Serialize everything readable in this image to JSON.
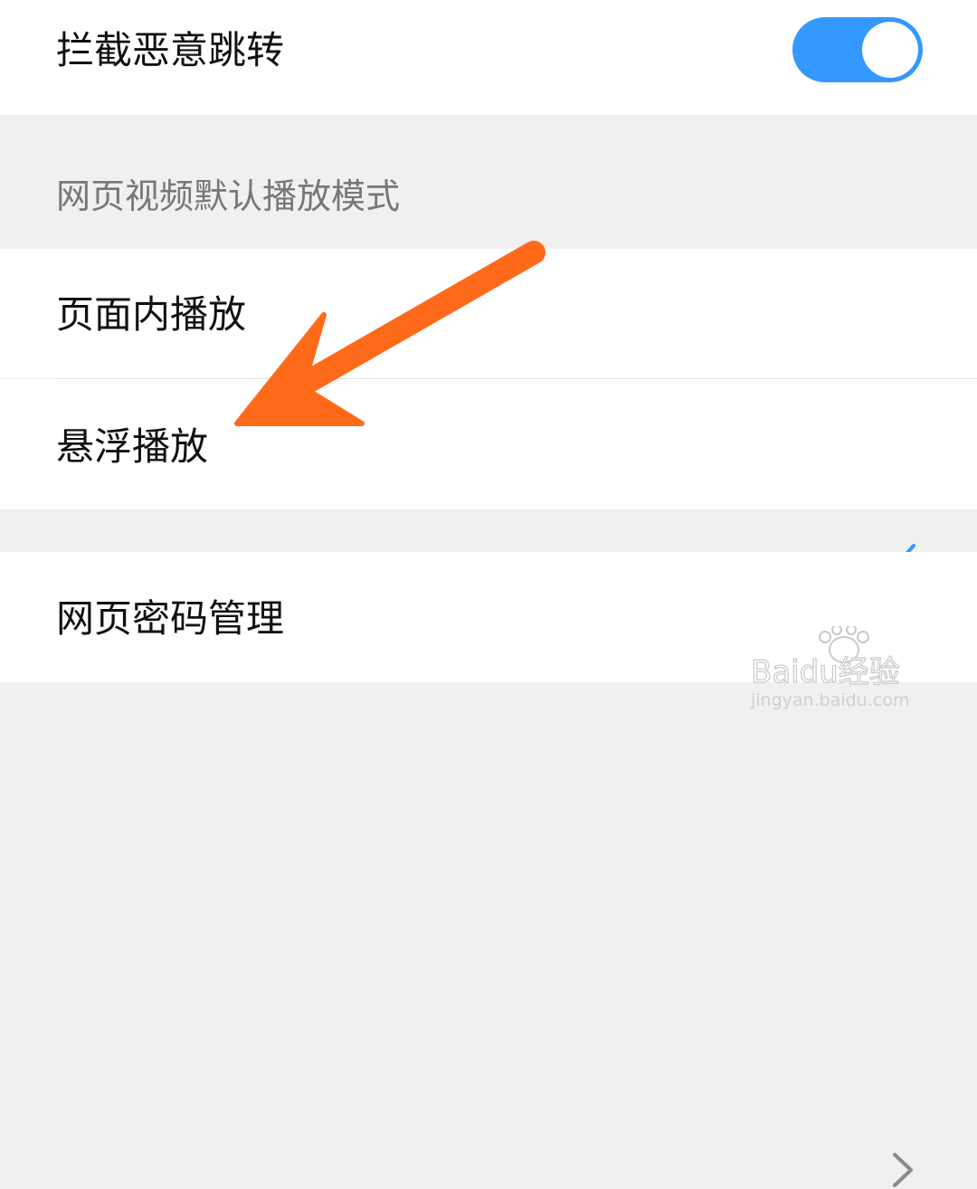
{
  "settings": {
    "block_redirect": {
      "label": "拦截恶意跳转",
      "enabled": true
    },
    "video_section": {
      "title": "网页视频默认播放模式",
      "options": [
        {
          "label": "页面内播放",
          "selected": true
        },
        {
          "label": "悬浮播放",
          "selected": false
        }
      ]
    },
    "password_manager": {
      "label": "网页密码管理"
    }
  },
  "annotation": {
    "color": "#ff6a1a"
  },
  "colors": {
    "accent": "#3399ff",
    "background": "#f0f0f0",
    "row": "#ffffff",
    "text": "#111111",
    "secondary_text": "#777777"
  },
  "icons": {
    "toggle": "toggle-switch-on",
    "selected": "checkmark-icon",
    "navigate": "chevron-right-icon",
    "annotation": "arrow-icon",
    "watermark": "baidu-jingyan-logo"
  },
  "watermark": {
    "brand": "Baidu经验",
    "url": "jingyan.baidu.com"
  }
}
